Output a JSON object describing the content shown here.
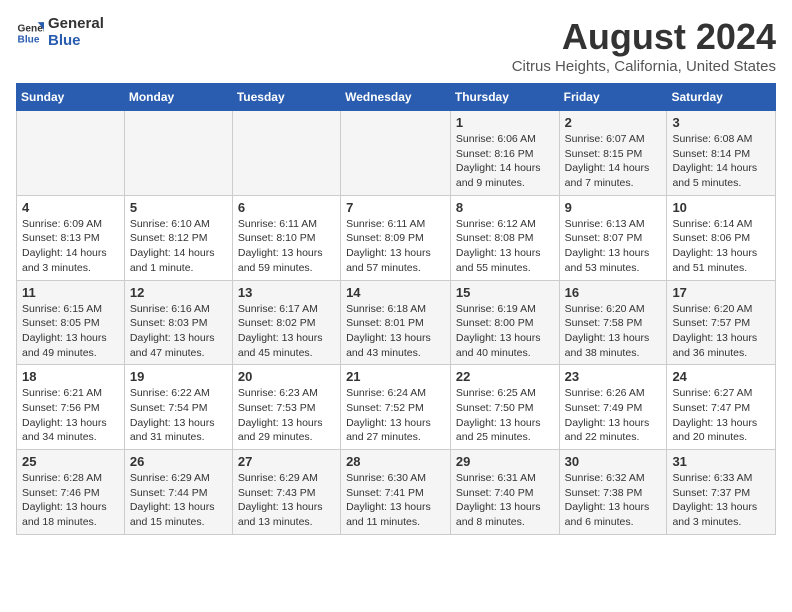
{
  "logo": {
    "line1": "General",
    "line2": "Blue"
  },
  "title": "August 2024",
  "subtitle": "Citrus Heights, California, United States",
  "weekdays": [
    "Sunday",
    "Monday",
    "Tuesday",
    "Wednesday",
    "Thursday",
    "Friday",
    "Saturday"
  ],
  "weeks": [
    [
      {
        "day": "",
        "info": ""
      },
      {
        "day": "",
        "info": ""
      },
      {
        "day": "",
        "info": ""
      },
      {
        "day": "",
        "info": ""
      },
      {
        "day": "1",
        "info": "Sunrise: 6:06 AM\nSunset: 8:16 PM\nDaylight: 14 hours\nand 9 minutes."
      },
      {
        "day": "2",
        "info": "Sunrise: 6:07 AM\nSunset: 8:15 PM\nDaylight: 14 hours\nand 7 minutes."
      },
      {
        "day": "3",
        "info": "Sunrise: 6:08 AM\nSunset: 8:14 PM\nDaylight: 14 hours\nand 5 minutes."
      }
    ],
    [
      {
        "day": "4",
        "info": "Sunrise: 6:09 AM\nSunset: 8:13 PM\nDaylight: 14 hours\nand 3 minutes."
      },
      {
        "day": "5",
        "info": "Sunrise: 6:10 AM\nSunset: 8:12 PM\nDaylight: 14 hours\nand 1 minute."
      },
      {
        "day": "6",
        "info": "Sunrise: 6:11 AM\nSunset: 8:10 PM\nDaylight: 13 hours\nand 59 minutes."
      },
      {
        "day": "7",
        "info": "Sunrise: 6:11 AM\nSunset: 8:09 PM\nDaylight: 13 hours\nand 57 minutes."
      },
      {
        "day": "8",
        "info": "Sunrise: 6:12 AM\nSunset: 8:08 PM\nDaylight: 13 hours\nand 55 minutes."
      },
      {
        "day": "9",
        "info": "Sunrise: 6:13 AM\nSunset: 8:07 PM\nDaylight: 13 hours\nand 53 minutes."
      },
      {
        "day": "10",
        "info": "Sunrise: 6:14 AM\nSunset: 8:06 PM\nDaylight: 13 hours\nand 51 minutes."
      }
    ],
    [
      {
        "day": "11",
        "info": "Sunrise: 6:15 AM\nSunset: 8:05 PM\nDaylight: 13 hours\nand 49 minutes."
      },
      {
        "day": "12",
        "info": "Sunrise: 6:16 AM\nSunset: 8:03 PM\nDaylight: 13 hours\nand 47 minutes."
      },
      {
        "day": "13",
        "info": "Sunrise: 6:17 AM\nSunset: 8:02 PM\nDaylight: 13 hours\nand 45 minutes."
      },
      {
        "day": "14",
        "info": "Sunrise: 6:18 AM\nSunset: 8:01 PM\nDaylight: 13 hours\nand 43 minutes."
      },
      {
        "day": "15",
        "info": "Sunrise: 6:19 AM\nSunset: 8:00 PM\nDaylight: 13 hours\nand 40 minutes."
      },
      {
        "day": "16",
        "info": "Sunrise: 6:20 AM\nSunset: 7:58 PM\nDaylight: 13 hours\nand 38 minutes."
      },
      {
        "day": "17",
        "info": "Sunrise: 6:20 AM\nSunset: 7:57 PM\nDaylight: 13 hours\nand 36 minutes."
      }
    ],
    [
      {
        "day": "18",
        "info": "Sunrise: 6:21 AM\nSunset: 7:56 PM\nDaylight: 13 hours\nand 34 minutes."
      },
      {
        "day": "19",
        "info": "Sunrise: 6:22 AM\nSunset: 7:54 PM\nDaylight: 13 hours\nand 31 minutes."
      },
      {
        "day": "20",
        "info": "Sunrise: 6:23 AM\nSunset: 7:53 PM\nDaylight: 13 hours\nand 29 minutes."
      },
      {
        "day": "21",
        "info": "Sunrise: 6:24 AM\nSunset: 7:52 PM\nDaylight: 13 hours\nand 27 minutes."
      },
      {
        "day": "22",
        "info": "Sunrise: 6:25 AM\nSunset: 7:50 PM\nDaylight: 13 hours\nand 25 minutes."
      },
      {
        "day": "23",
        "info": "Sunrise: 6:26 AM\nSunset: 7:49 PM\nDaylight: 13 hours\nand 22 minutes."
      },
      {
        "day": "24",
        "info": "Sunrise: 6:27 AM\nSunset: 7:47 PM\nDaylight: 13 hours\nand 20 minutes."
      }
    ],
    [
      {
        "day": "25",
        "info": "Sunrise: 6:28 AM\nSunset: 7:46 PM\nDaylight: 13 hours\nand 18 minutes."
      },
      {
        "day": "26",
        "info": "Sunrise: 6:29 AM\nSunset: 7:44 PM\nDaylight: 13 hours\nand 15 minutes."
      },
      {
        "day": "27",
        "info": "Sunrise: 6:29 AM\nSunset: 7:43 PM\nDaylight: 13 hours\nand 13 minutes."
      },
      {
        "day": "28",
        "info": "Sunrise: 6:30 AM\nSunset: 7:41 PM\nDaylight: 13 hours\nand 11 minutes."
      },
      {
        "day": "29",
        "info": "Sunrise: 6:31 AM\nSunset: 7:40 PM\nDaylight: 13 hours\nand 8 minutes."
      },
      {
        "day": "30",
        "info": "Sunrise: 6:32 AM\nSunset: 7:38 PM\nDaylight: 13 hours\nand 6 minutes."
      },
      {
        "day": "31",
        "info": "Sunrise: 6:33 AM\nSunset: 7:37 PM\nDaylight: 13 hours\nand 3 minutes."
      }
    ]
  ]
}
